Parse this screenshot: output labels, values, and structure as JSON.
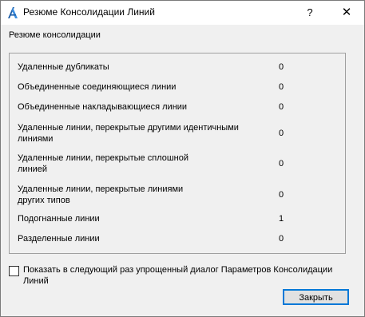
{
  "window": {
    "title": "Резюме Консолидации Линий",
    "help_label": "?",
    "close_label": "✕"
  },
  "summary": {
    "caption": "Резюме консолидации",
    "rows": [
      {
        "label": "Удаленные дубликаты",
        "value": "0"
      },
      {
        "label": "Объединенные соединяющиеся линии",
        "value": "0"
      },
      {
        "label": "Объединенные накладывающиеся линии",
        "value": "0"
      },
      {
        "label": "Удаленные линии, перекрытые другими идентичными линиями",
        "value": "0"
      },
      {
        "label": "Удаленные линии, перекрытые сплошной линией",
        "value": "0"
      },
      {
        "label": "Удаленные линии, перекрытые линиями других типов",
        "value": "0"
      },
      {
        "label": "Подогнанные линии",
        "value": "1"
      },
      {
        "label": "Разделенные линии",
        "value": "0"
      }
    ]
  },
  "option": {
    "checked": false,
    "label": "Показать в следующий раз упрощенный диалог Параметров Консолидации Линий"
  },
  "buttons": {
    "close_label": "Закрыть"
  }
}
